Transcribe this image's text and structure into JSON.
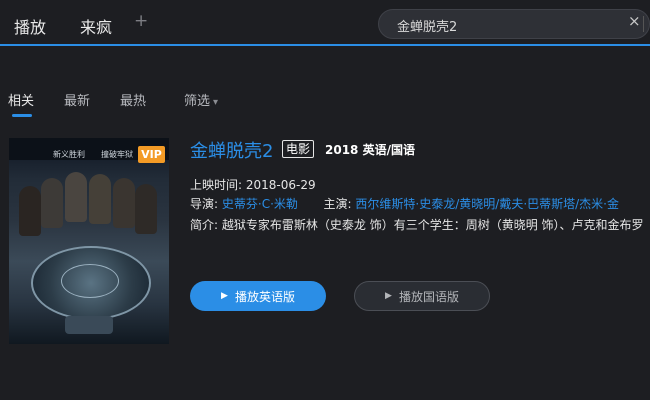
{
  "tabs": {
    "active": "播放",
    "second": "来疯",
    "add": "+"
  },
  "search": {
    "value": "金蝉脱壳2",
    "clear_icon": "×"
  },
  "filters": {
    "items": [
      "相关",
      "最新",
      "最热",
      "筛选"
    ],
    "dropdown_icon": "chevron-down-icon"
  },
  "poster": {
    "title_left": "新义胜利",
    "title_right": "撞破牢狱",
    "badge": "VIP"
  },
  "movie": {
    "title": "金蝉脱壳2",
    "type": "电影",
    "meta": "2018  英语/国语",
    "release_label": "上映时间:",
    "release_date": "2018-06-29",
    "director_label": "导演:",
    "director": "史蒂芬·C·米勒",
    "cast_label": "主演:",
    "cast": "西尔维斯特·史泰龙/黄晓明/戴夫·巴蒂斯塔/杰米·金",
    "desc_label": "简介:",
    "desc": "越狱专家布雷斯林（史泰龙 饰）有三个学生：周树（黄晓明 饰）、卢克和金布罗"
  },
  "buttons": {
    "primary": "播放英语版",
    "secondary": "播放国语版"
  },
  "colors": {
    "accent": "#2b8ee6",
    "background": "#1d1e22",
    "vip": "#f39b26"
  }
}
